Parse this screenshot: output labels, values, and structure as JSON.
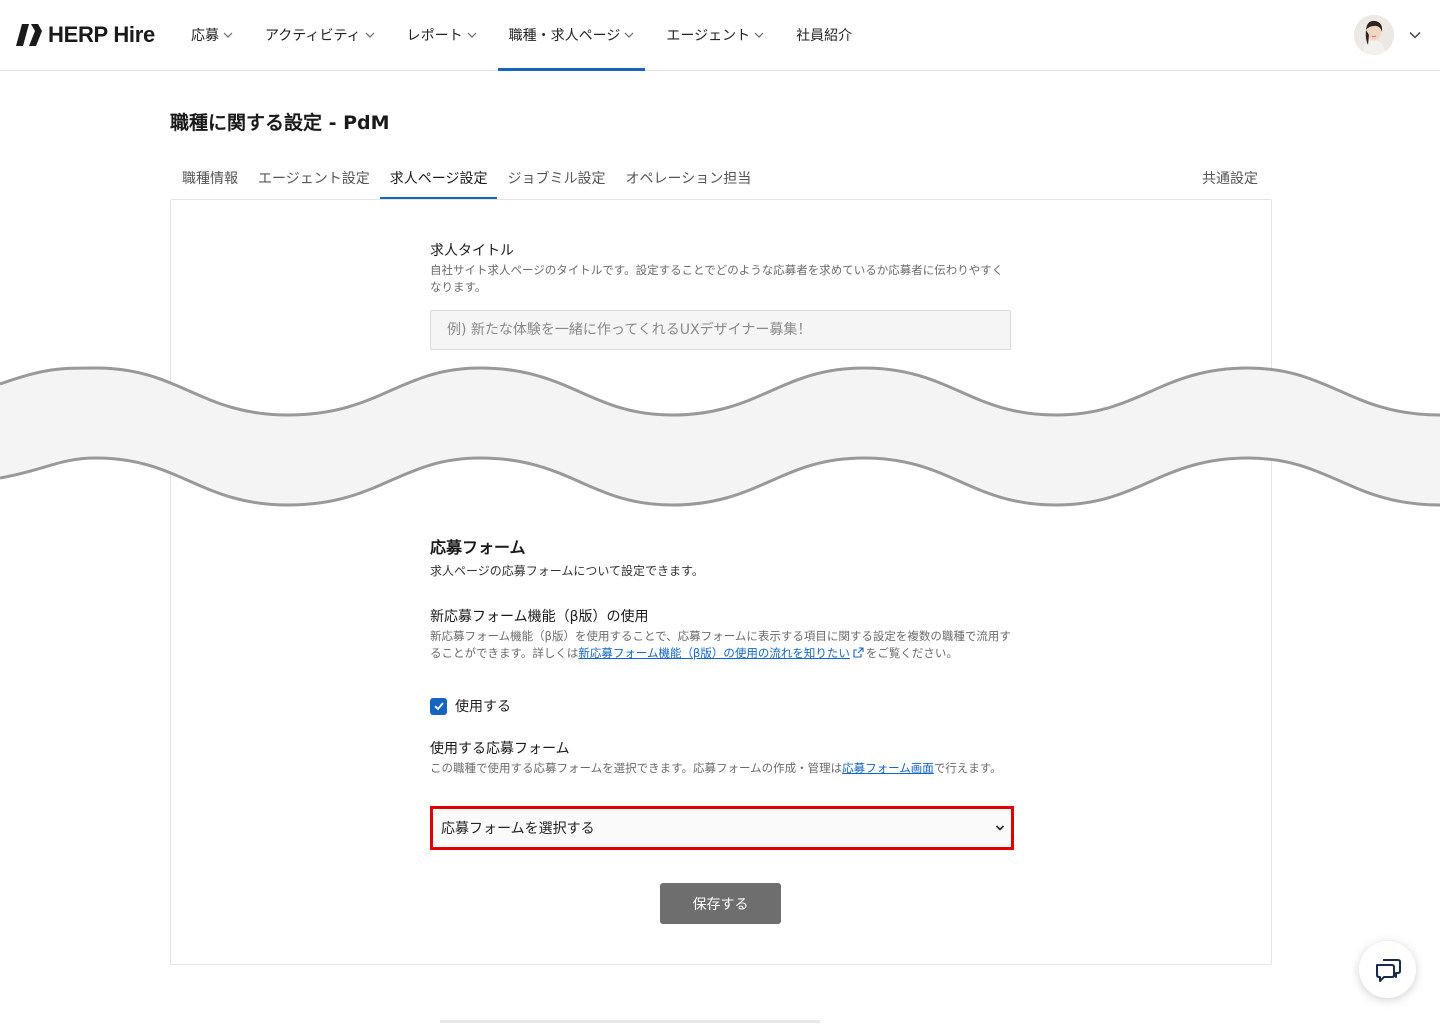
{
  "header": {
    "logo_text": "HERP Hire",
    "nav": [
      {
        "label": "応募",
        "has_dropdown": true,
        "active": false
      },
      {
        "label": "アクティビティ",
        "has_dropdown": true,
        "active": false
      },
      {
        "label": "レポート",
        "has_dropdown": true,
        "active": false
      },
      {
        "label": "職種・求人ページ",
        "has_dropdown": true,
        "active": true
      },
      {
        "label": "エージェント",
        "has_dropdown": true,
        "active": false
      },
      {
        "label": "社員紹介",
        "has_dropdown": false,
        "active": false
      }
    ]
  },
  "page": {
    "title": "職種に関する設定 - PdM"
  },
  "tabs": {
    "items": [
      "職種情報",
      "エージェント設定",
      "求人ページ設定",
      "ジョブミル設定",
      "オペレーション担当"
    ],
    "active": "求人ページ設定",
    "common": "共通設定"
  },
  "job_title": {
    "label": "求人タイトル",
    "description": "自社サイト求人ページのタイトルです。設定することでどのような応募者を求めているか応募者に伝わりやすくなります。",
    "placeholder": "例) 新たな体験を一緒に作ってくれるUXデザイナー募集！"
  },
  "apply_form": {
    "heading": "応募フォーム",
    "description": "求人ページの応募フォームについて設定できます。",
    "new_form_label": "新応募フォーム機能（β版）の使用",
    "new_form_desc_prefix": "新応募フォーム機能（β版）を使用することで、応募フォームに表示する項目に関する設定を複数の職種で流用することができます。詳しくは",
    "new_form_link": "新応募フォーム機能（β版）の使用の流れを知りたい",
    "new_form_desc_suffix": "をご覧ください。",
    "use_checkbox_label": "使用する",
    "use_checked": true,
    "select_label": "使用する応募フォーム",
    "select_desc_prefix": "この職種で使用する応募フォームを選択できます。応募フォームの作成・管理は",
    "select_desc_link": "応募フォーム画面",
    "select_desc_suffix": "で行えます。",
    "select_value": "応募フォームを選択する"
  },
  "actions": {
    "save_label": "保存する"
  },
  "colors": {
    "accent": "#1565c0",
    "highlight": "#e00000",
    "save_button": "#6e6e6e"
  },
  "icons": {
    "chevron": "chevron-down-icon",
    "chat": "chat-icon",
    "external": "external-link-icon",
    "check": "check-icon"
  }
}
